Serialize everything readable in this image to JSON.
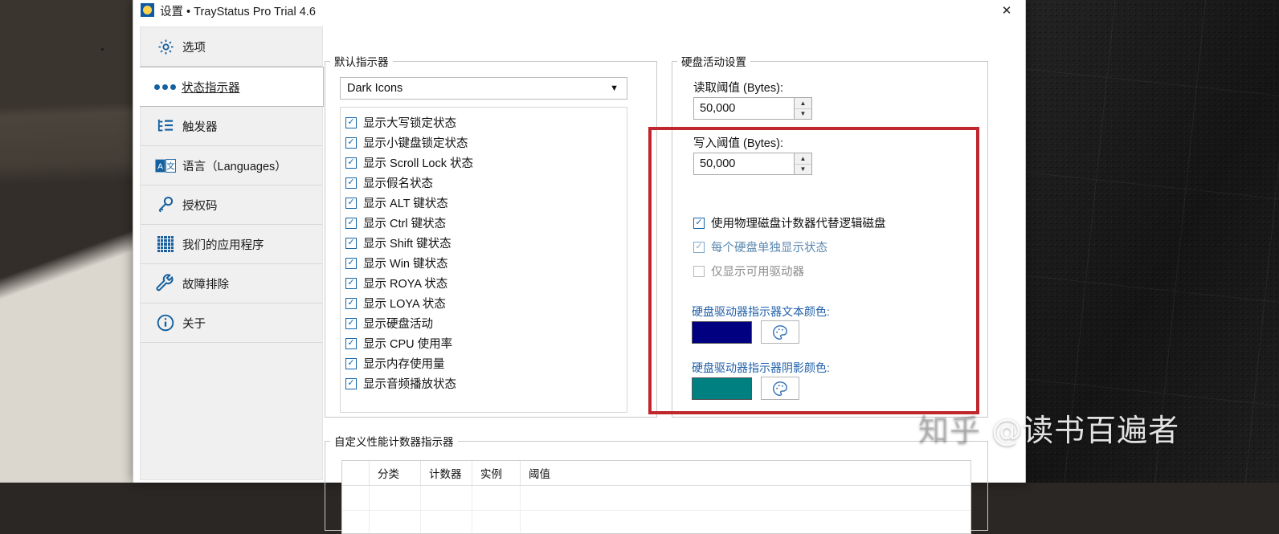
{
  "window": {
    "title": "设置 • TrayStatus Pro Trial 4.6",
    "app_icon": "traystatus-icon",
    "close_label": "✕"
  },
  "sidebar": {
    "items": [
      {
        "label": "选项",
        "icon": "gear-icon",
        "selected": false
      },
      {
        "label": "状态指示器",
        "icon": "three-dots-icon",
        "selected": true
      },
      {
        "label": "触发器",
        "icon": "trigger-tree-icon",
        "selected": false
      },
      {
        "label": "语言（Languages）",
        "icon": "language-icon",
        "selected": false
      },
      {
        "label": "授权码",
        "icon": "key-icon",
        "selected": false
      },
      {
        "label": "我们的应用程序",
        "icon": "app-grid-icon",
        "selected": false
      },
      {
        "label": "故障排除",
        "icon": "wrench-icon",
        "selected": false
      },
      {
        "label": "关于",
        "icon": "info-icon",
        "selected": false
      }
    ]
  },
  "default_indicators": {
    "legend": "默认指示器",
    "theme_select": {
      "value": "Dark Icons",
      "arrow": "▼"
    },
    "checkboxes": [
      {
        "label": "显示大写锁定状态",
        "checked": true
      },
      {
        "label": "显示小键盘锁定状态",
        "checked": true
      },
      {
        "label": "显示 Scroll Lock 状态",
        "checked": true
      },
      {
        "label": "显示假名状态",
        "checked": true
      },
      {
        "label": "显示 ALT 键状态",
        "checked": true
      },
      {
        "label": "显示 Ctrl 键状态",
        "checked": true
      },
      {
        "label": "显示 Shift 键状态",
        "checked": true
      },
      {
        "label": "显示 Win 键状态",
        "checked": true
      },
      {
        "label": "显示 ROYA 状态",
        "checked": true
      },
      {
        "label": "显示 LOYA 状态",
        "checked": true
      },
      {
        "label": "显示硬盘活动",
        "checked": true
      },
      {
        "label": "显示 CPU 使用率",
        "checked": true
      },
      {
        "label": "显示内存使用量",
        "checked": true
      },
      {
        "label": "显示音频播放状态",
        "checked": true
      }
    ]
  },
  "disk_activity": {
    "legend": "硬盘活动设置",
    "read_threshold": {
      "label": "读取阈值 (Bytes):",
      "value": "50,000"
    },
    "write_threshold": {
      "label": "写入阈值 (Bytes):",
      "value": "50,000"
    },
    "options": [
      {
        "label": "使用物理磁盘计数器代替逻辑磁盘",
        "checked": true,
        "state": "normal"
      },
      {
        "label": "每个硬盘单独显示状态",
        "checked": true,
        "state": "dim"
      },
      {
        "label": "仅显示可用驱动器",
        "checked": false,
        "state": "gray"
      }
    ],
    "text_color": {
      "label": "硬盘驱动器指示器文本颜色:",
      "value": "#000080"
    },
    "shadow_color": {
      "label": "硬盘驱动器指示器阴影颜色:",
      "value": "#008080"
    },
    "palette_icon": "palette-icon"
  },
  "perf_counters": {
    "legend": "自定义性能计数器指示器",
    "columns": [
      "",
      "分类",
      "计数器",
      "实例",
      "阈值"
    ]
  },
  "annotation": {
    "type": "red-rectangle",
    "color": "#c0272d"
  },
  "watermark": {
    "zhihu": "知乎",
    "handle": "@读书百遍者"
  }
}
